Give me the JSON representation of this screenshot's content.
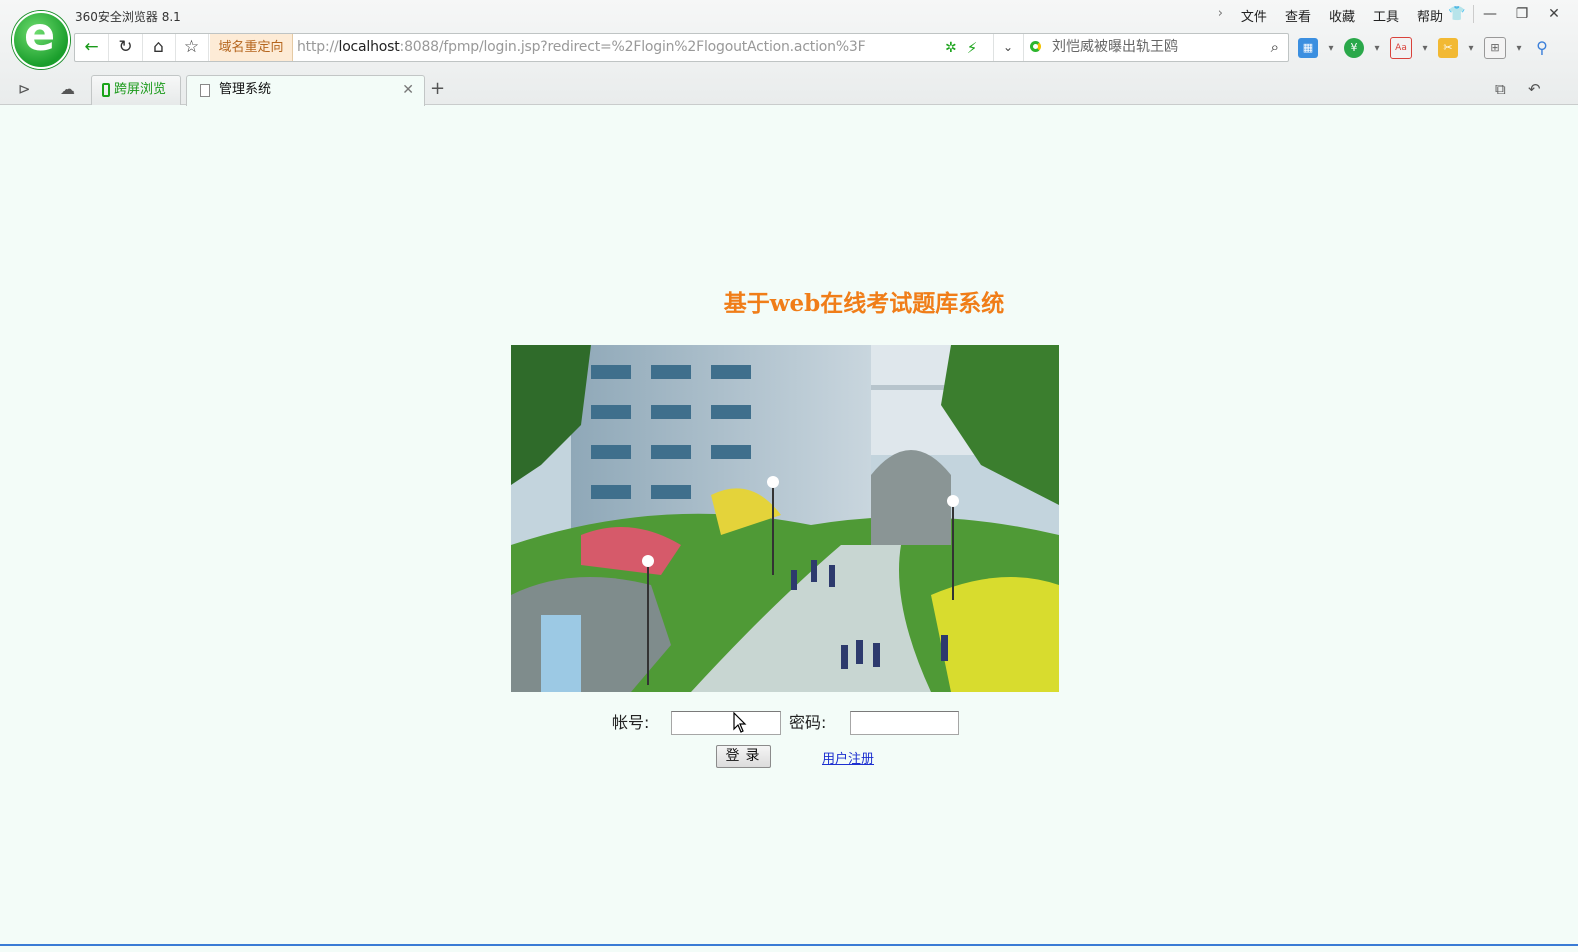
{
  "browser": {
    "app_title": "360安全浏览器 8.1",
    "menu": [
      "文件",
      "查看",
      "收藏",
      "工具",
      "帮助"
    ],
    "redirect_badge": "域名重定向",
    "url_prefix": "http://",
    "url_host": "localhost",
    "url_rest": ":8088/fpmp/login.jsp?redirect=%2Flogin%2FlogoutAction.action%3F",
    "search_text": "刘恺威被曝出轨王鸥",
    "tabs": {
      "screen_tab": "跨屏浏览",
      "active_tab": "管理系统"
    },
    "accent": "#1a9a1a"
  },
  "page": {
    "title": "基于web在线考试题库系统",
    "title_color": "#f07d18",
    "account_label": "帐号:",
    "password_label": "密码:",
    "account_value": "",
    "password_value": "",
    "login_button": "登录",
    "register_link": "用户注册"
  }
}
